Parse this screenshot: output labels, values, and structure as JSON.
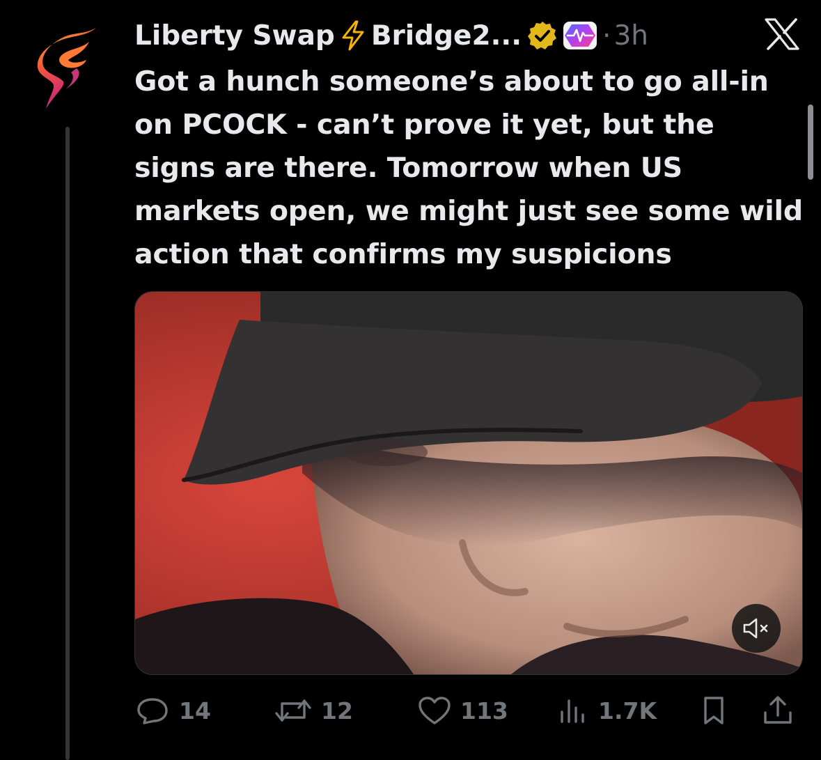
{
  "author": {
    "name_part1": "Liberty Swap",
    "name_part2": "Bridge2...",
    "separator": "·",
    "time": "3h",
    "avatar_icon": "flame-s-logo-icon",
    "verified_icon": "verified-badge-icon",
    "affiliate_icon": "pulse-affiliate-badge-icon"
  },
  "platform": {
    "logo_icon": "x-logo-icon"
  },
  "tweet": {
    "text": "Got a hunch someone’s about to go all-in on PCOCK - can’t prove it yet, but the signs are there. Tomorrow when US markets open, we might just see some wild action that confirms my suspicions"
  },
  "media": {
    "type": "video",
    "subject": "man-in-black-cap",
    "mute_icon": "speaker-muted-icon"
  },
  "actions": {
    "replies": "14",
    "reposts": "12",
    "likes": "113",
    "views": "1.7K",
    "bookmark_icon": "bookmark-icon",
    "share_icon": "share-icon"
  },
  "colors": {
    "background": "#000000",
    "text": "#e7e9ea",
    "muted": "#71767b",
    "verified_gold": "#e2b719"
  }
}
